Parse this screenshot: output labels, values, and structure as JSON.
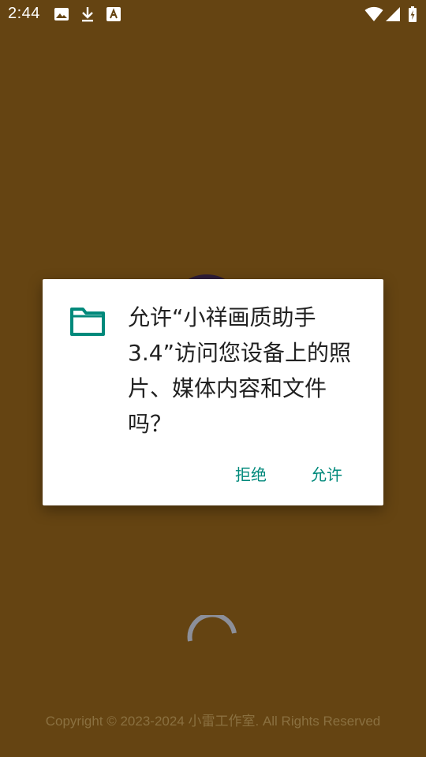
{
  "status_bar": {
    "time": "2:44",
    "icons": [
      "image-icon",
      "download-icon",
      "font-icon",
      "wifi-icon",
      "signal-icon",
      "battery-icon"
    ]
  },
  "dialog": {
    "icon": "folder-icon",
    "message": "允许“小祥画质助手3.4”访问您设备上的照片、媒体内容和文件吗？",
    "deny_label": "拒绝",
    "allow_label": "允许"
  },
  "footer": {
    "copyright": "Copyright © 2023-2024 小雷工作室. All Rights Reserved"
  },
  "colors": {
    "background": "#654412",
    "accent": "#00897b",
    "dialog": "#ffffff"
  }
}
